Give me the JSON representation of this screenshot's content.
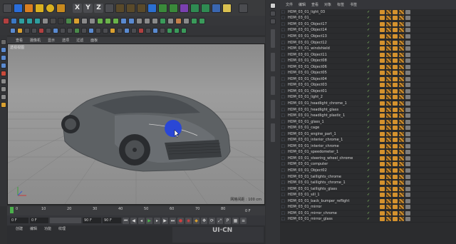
{
  "viewport": {
    "label": "透视视图",
    "menu": [
      "查看",
      "摄像机",
      "显示",
      "选项",
      "过滤",
      "面板"
    ],
    "scale_label": "网格间距 : 100 cm"
  },
  "toolbar": {
    "xyz": [
      "X",
      "Y",
      "Z"
    ]
  },
  "object_manager": {
    "menu": [
      "文件",
      "编辑",
      "查看",
      "对象",
      "标签",
      "书签"
    ],
    "objects": [
      "HDM_03_01_light_03",
      "HDM_03_01_",
      "HDM_03_01_Object17",
      "HDM_03_01_Object14",
      "HDM_03_01_Object13",
      "HDM_03_01_Object12",
      "HDM_03_01_windshield",
      "HDM_03_01_Object11",
      "HDM_03_01_Object08",
      "HDM_03_01_Object06",
      "HDM_03_01_Object05",
      "HDM_03_01_Object04",
      "HDM_03_01_Object03",
      "HDM_03_01_Object01",
      "HDM_03_01_light_2",
      "HDM_03_01_headlight_chrome_1",
      "HDM_03_01_headlight_glass",
      "HDM_03_01_headlight_plastic_1",
      "HDM_03_01_glass_1",
      "HDM_03_01_cage",
      "HDM_03_01_engine_part_1",
      "HDM_03_01_interior_chrome_1",
      "HDM_03_01_interior_chrome",
      "HDM_03_01_speedometer_1",
      "HDM_03_01_steering_wheel_chrome",
      "HDM_03_01_computer",
      "HDM_03_01_Object02",
      "HDM_03_01_taillights_chrome",
      "HDM_03_01_taillights_chrome_1",
      "HDM_03_01_taillights_glass",
      "HDM_03_01_sill_1",
      "HDM_03_01_back_bumper_reflight",
      "HDM_03_01_mirror",
      "HDM_03_01_mirror_chrome",
      "HDM_03_01_mirror_glass"
    ]
  },
  "timeline": {
    "ticks": [
      "0",
      "10",
      "20",
      "30",
      "40",
      "50",
      "60",
      "70",
      "80",
      "90"
    ],
    "frame_end": "0 F"
  },
  "time_controls": {
    "start": "0 F",
    "current": "0 F",
    "end": "90 F",
    "end2": "90 F"
  },
  "bottom": {
    "menu": [
      "创建",
      "编辑",
      "功能",
      "纹理"
    ]
  },
  "watermark": "UI·CN",
  "colors": {
    "accent_blue": "#2a47d6",
    "tag_orange": "#d4922e",
    "check_green": "#8fd36a"
  }
}
